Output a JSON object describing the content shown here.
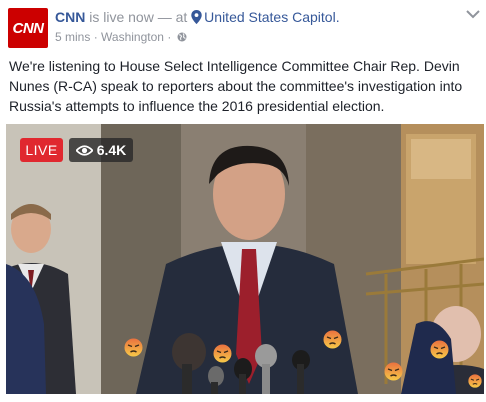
{
  "post": {
    "avatar_text": "CNN",
    "page_name": "CNN",
    "status_text": " is live now — at ",
    "location": "United States Capitol.",
    "time": "5 mins",
    "separator": "·",
    "place": "Washington",
    "separator2": "·",
    "privacy_icon": "globe-icon",
    "menu_icon": "chevron-down-icon",
    "message": "We're listening to House Select Intelligence Committee Chair Rep. Devin Nunes (R-CA) speak to reporters about the committee's investigation into Russia's attempts to influence the 2016 presidential election."
  },
  "video": {
    "live_label": "LIVE",
    "viewers": "6.4K",
    "viewers_icon": "eye-icon",
    "reactions": [
      "angry",
      "angry",
      "angry",
      "angry",
      "angry",
      "angry"
    ]
  },
  "colors": {
    "brand_red": "#cc0000",
    "link_blue": "#365899",
    "meta_gray": "#90949c",
    "live_red": "#e0282f"
  }
}
